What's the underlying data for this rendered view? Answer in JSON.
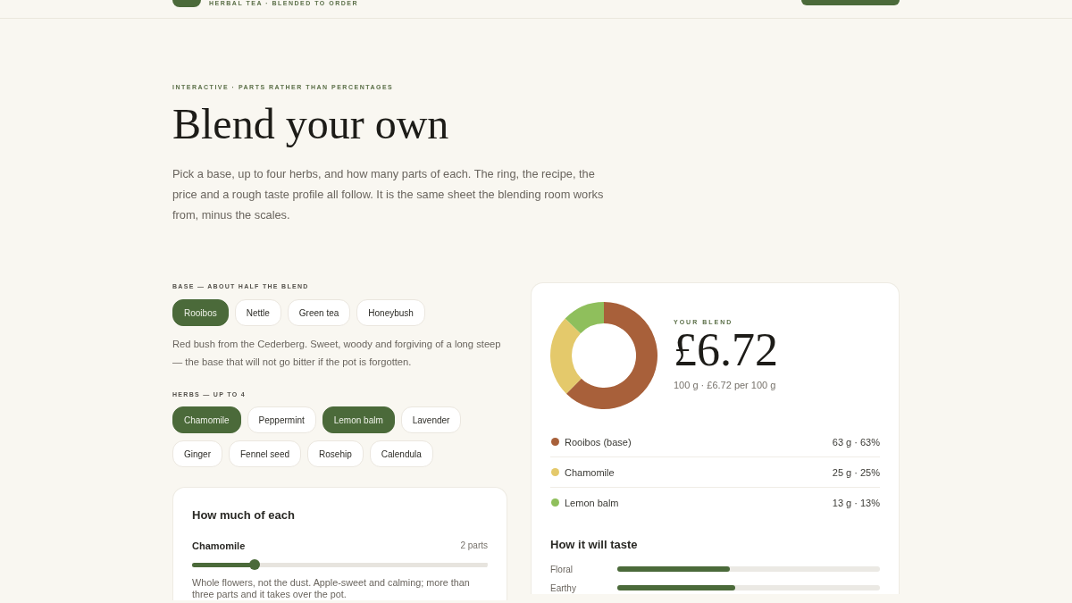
{
  "header": {
    "tagline": "HERBAL TEA · BLENDED TO ORDER"
  },
  "intro": {
    "eyebrow": "INTERACTIVE · PARTS RATHER THAN PERCENTAGES",
    "title": "Blend your own",
    "text": "Pick a base, up to four herbs, and how many parts of each. The ring, the recipe, the price and a rough taste profile all follow. It is the same sheet the blending room works from, minus the scales."
  },
  "base": {
    "label": "BASE — ABOUT HALF THE BLEND",
    "options": [
      {
        "label": "Rooibos",
        "selected": true
      },
      {
        "label": "Nettle",
        "selected": false
      },
      {
        "label": "Green tea",
        "selected": false
      },
      {
        "label": "Honeybush",
        "selected": false
      }
    ],
    "description": "Red bush from the Cederberg. Sweet, woody and forgiving of a long steep — the base that will not go bitter if the pot is forgotten."
  },
  "herbs": {
    "label": "HERBS — UP TO 4",
    "options": [
      {
        "label": "Chamomile",
        "selected": true
      },
      {
        "label": "Peppermint",
        "selected": false
      },
      {
        "label": "Lemon balm",
        "selected": true
      },
      {
        "label": "Lavender",
        "selected": false
      },
      {
        "label": "Ginger",
        "selected": false
      },
      {
        "label": "Fennel seed",
        "selected": false
      },
      {
        "label": "Rosehip",
        "selected": false
      },
      {
        "label": "Calendula",
        "selected": false
      }
    ]
  },
  "amounts": {
    "title": "How much of each",
    "sliders": [
      {
        "name": "Chamomile",
        "reading": "2 parts",
        "level": 0.21,
        "note": "Whole flowers, not the dust. Apple-sweet and calming; more than three parts and it takes over the pot."
      }
    ]
  },
  "summary": {
    "eyebrow": "YOUR BLEND",
    "price": "£6.72",
    "detail": "100 g · £6.72 per 100 g",
    "chart_data": {
      "type": "donut",
      "categories": [
        "Rooibos (base)",
        "Chamomile",
        "Lemon balm"
      ],
      "values": [
        63,
        25,
        13
      ]
    },
    "legend": [
      {
        "amount": "63 g · 63%",
        "color": "#a8603a"
      },
      {
        "amount": "25 g · 25%",
        "color": "#e4c96b"
      },
      {
        "amount": "13 g · 13%",
        "color": "#8fbf5c"
      }
    ]
  },
  "taste": {
    "title": "How it will taste",
    "rows": [
      {
        "label": "Floral",
        "level": 0.43
      },
      {
        "label": "Earthy",
        "level": 0.45
      }
    ]
  }
}
